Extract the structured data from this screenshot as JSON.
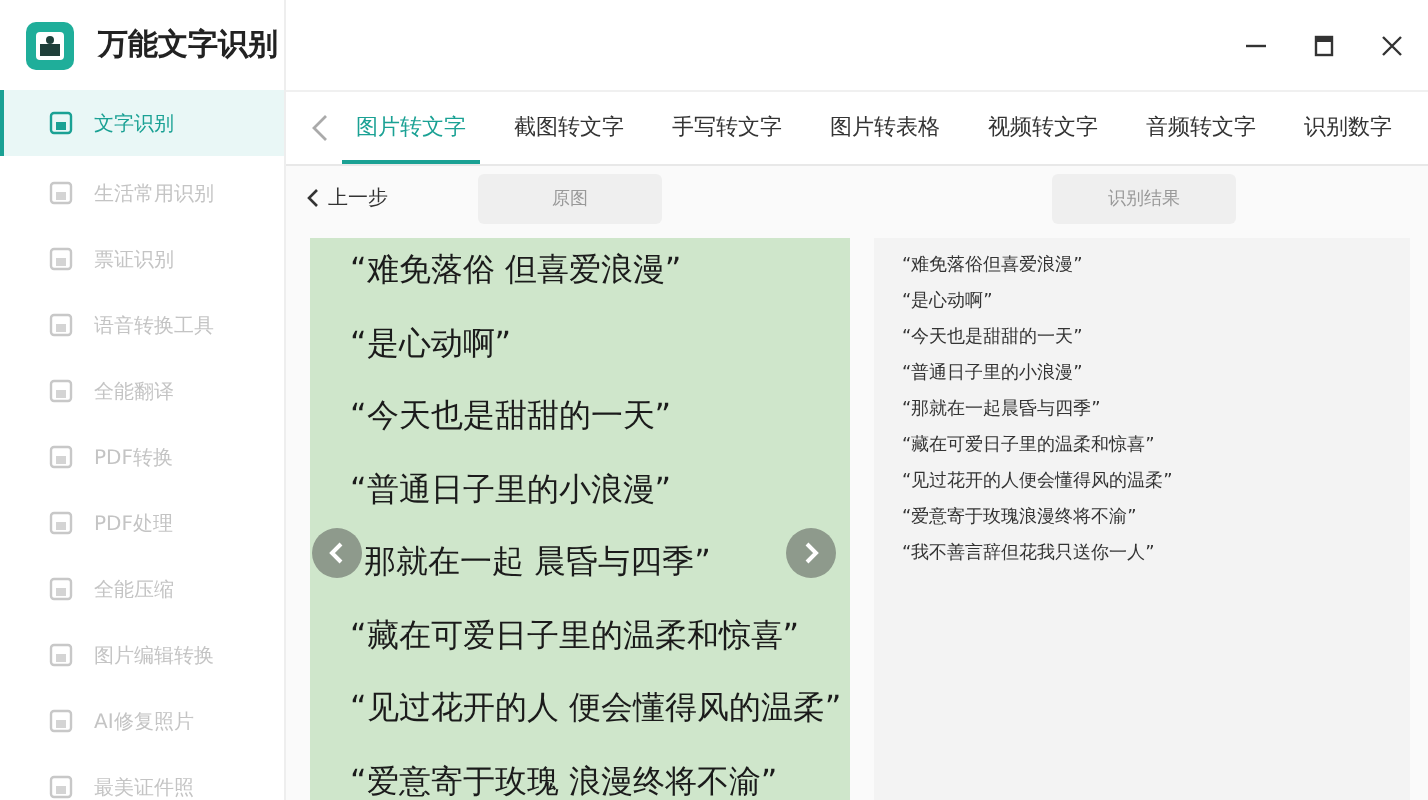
{
  "app": {
    "title": "万能文字识别"
  },
  "sidebar": {
    "items": [
      {
        "label": "文字识别",
        "selected": true
      },
      {
        "label": "生活常用识别",
        "selected": false
      },
      {
        "label": "票证识别",
        "selected": false
      },
      {
        "label": "语音转换工具",
        "selected": false
      },
      {
        "label": "全能翻译",
        "selected": false
      },
      {
        "label": "PDF转换",
        "selected": false
      },
      {
        "label": "PDF处理",
        "selected": false
      },
      {
        "label": "全能压缩",
        "selected": false
      },
      {
        "label": "图片编辑转换",
        "selected": false
      },
      {
        "label": "AI修复照片",
        "selected": false
      },
      {
        "label": "最美证件照",
        "selected": false
      }
    ]
  },
  "tabs": [
    {
      "label": "图片转文字",
      "selected": true
    },
    {
      "label": "截图转文字",
      "selected": false
    },
    {
      "label": "手写转文字",
      "selected": false
    },
    {
      "label": "图片转表格",
      "selected": false
    },
    {
      "label": "视频转文字",
      "selected": false
    },
    {
      "label": "音频转文字",
      "selected": false
    },
    {
      "label": "识别数字",
      "selected": false
    }
  ],
  "back": "上一步",
  "source_label": "原图",
  "result_label": "识别结果",
  "source_lines": [
    "“难免落俗  但喜爱浪漫”",
    "“是心动啊”",
    "“今天也是甜甜的一天”",
    "“普通日子里的小浪漫”",
    "那就在一起  晨昏与四季”",
    "“藏在可爱日子里的温柔和惊喜”",
    "“见过花开的人  便会懂得风的温柔”",
    "“爱意寄于玫瑰  浪漫终将不渝”"
  ],
  "result_lines": [
    "“难免落俗但喜爱浪漫”",
    "“是心动啊”",
    "“今天也是甜甜的一天”",
    "“普通日子里的小浪漫”",
    "“那就在一起晨昏与四季”",
    "“藏在可爱日子里的温柔和惊喜”",
    "“见过花开的人便会懂得风的温柔”",
    "“爱意寄于玫瑰浪漫终将不渝”",
    "“我不善言辞但花我只送你一人”"
  ]
}
